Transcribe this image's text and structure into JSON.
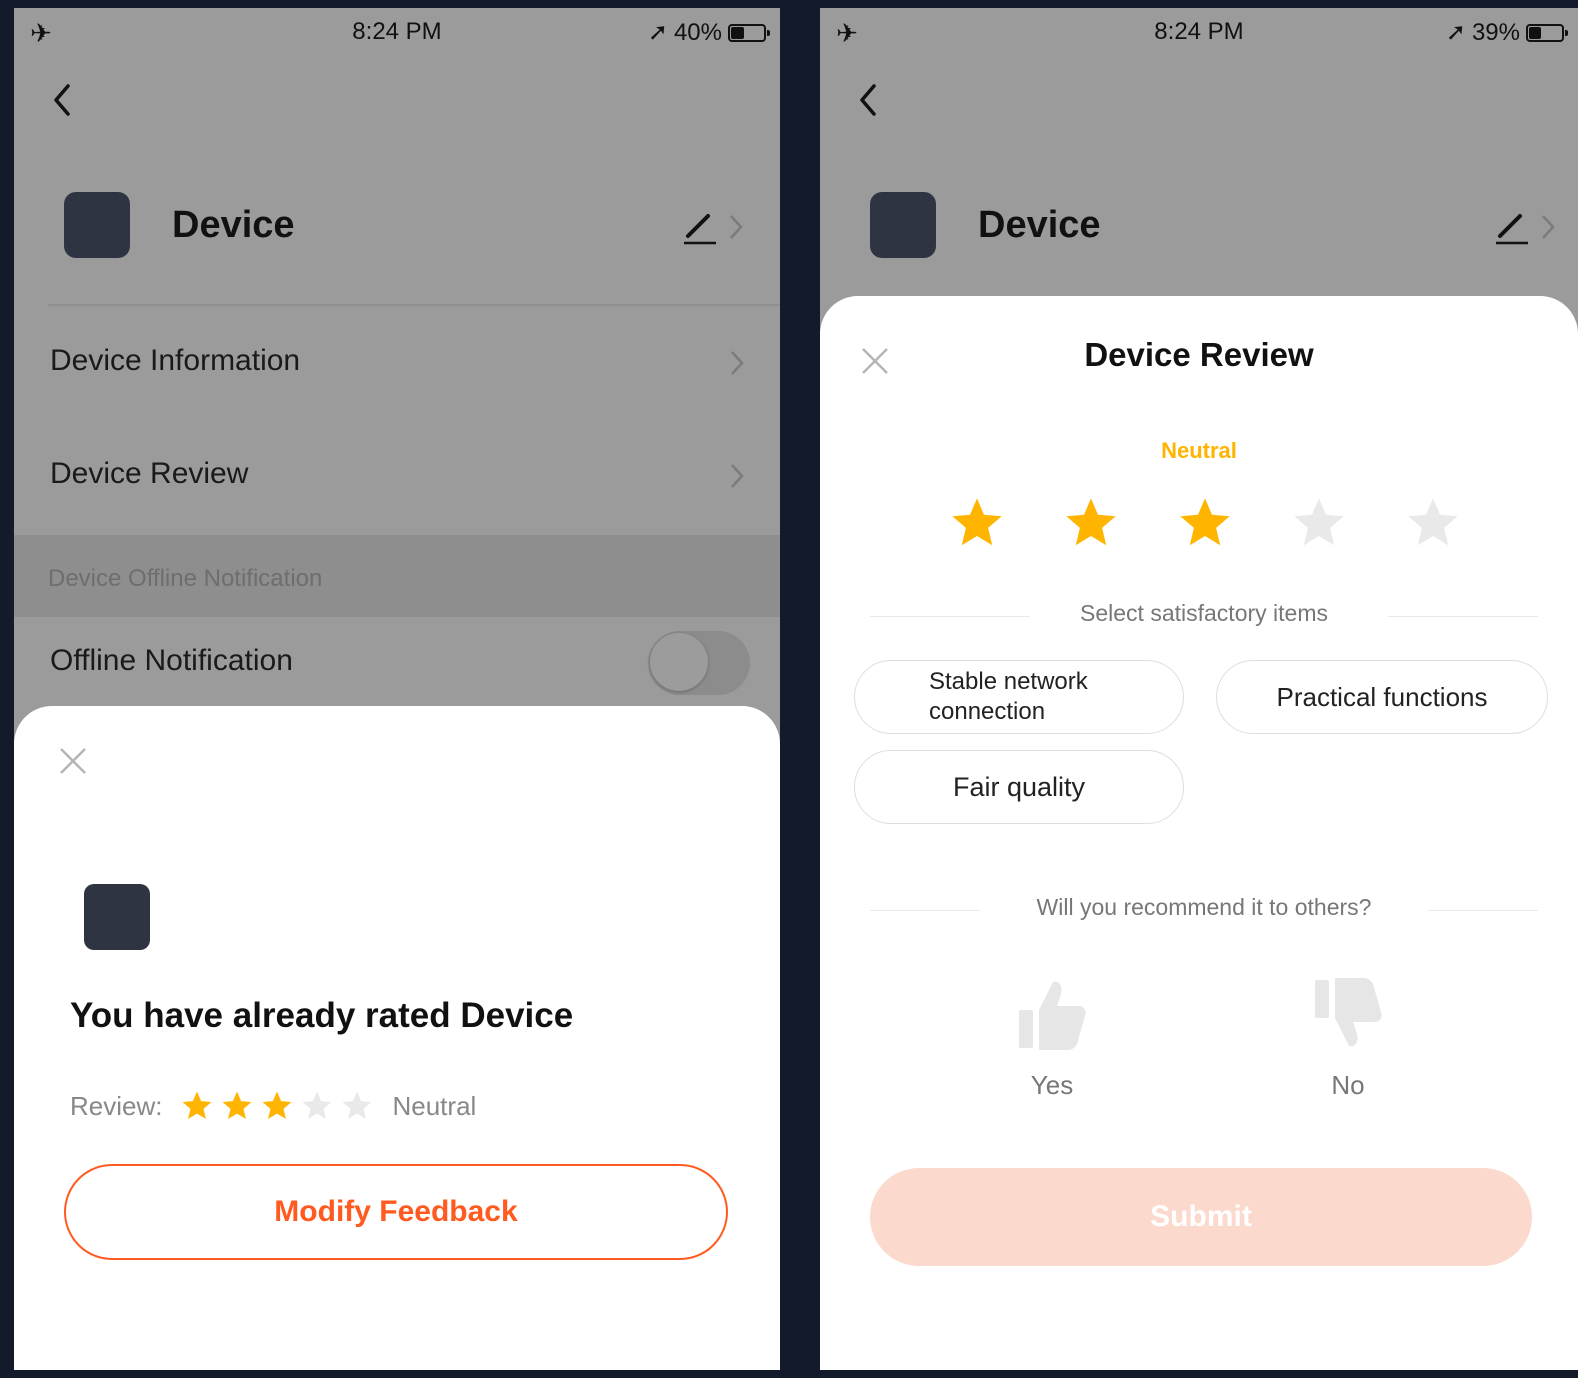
{
  "left_screen": {
    "status": {
      "time": "8:24 PM",
      "battery": "40%",
      "battery_level": 0.4
    },
    "device_name": "Device",
    "menu": {
      "device_information": "Device Information",
      "device_review": "Device Review",
      "offline_section": "Device Offline Notification",
      "offline_notification": "Offline Notification",
      "offline_toggle_on": false
    },
    "sheet": {
      "title": "You have already rated Device",
      "review_label": "Review:",
      "stars_filled": 3,
      "stars_total": 5,
      "rating_text": "Neutral",
      "modify_button": "Modify Feedback"
    }
  },
  "right_screen": {
    "status": {
      "time": "8:24 PM",
      "battery": "39%",
      "battery_level": 0.39
    },
    "device_name": "Device",
    "sheet": {
      "title": "Device Review",
      "rating_text": "Neutral",
      "stars_filled": 3,
      "stars_total": 5,
      "satisfactory_label": "Select satisfactory items",
      "chips": [
        "Stable network connection",
        "Practical functions",
        "Fair quality"
      ],
      "recommend_label": "Will you recommend it to others?",
      "yes_label": "Yes",
      "no_label": "No",
      "submit_button": "Submit"
    }
  },
  "colors": {
    "star_filled": "#ffb400",
    "star_empty": "#e9e9e9",
    "accent": "#ff5a1f",
    "submit_disabled": "#fbd9cd"
  },
  "icons": {
    "status_airplane": "airplane-icon",
    "status_location": "location-arrow-icon",
    "back": "back-arrow-icon",
    "edit": "pencil-icon",
    "chevron": "chevron-right-icon",
    "close": "close-icon",
    "star": "star-icon",
    "thumbs_up": "thumbs-up-icon",
    "thumbs_down": "thumbs-down-icon"
  }
}
